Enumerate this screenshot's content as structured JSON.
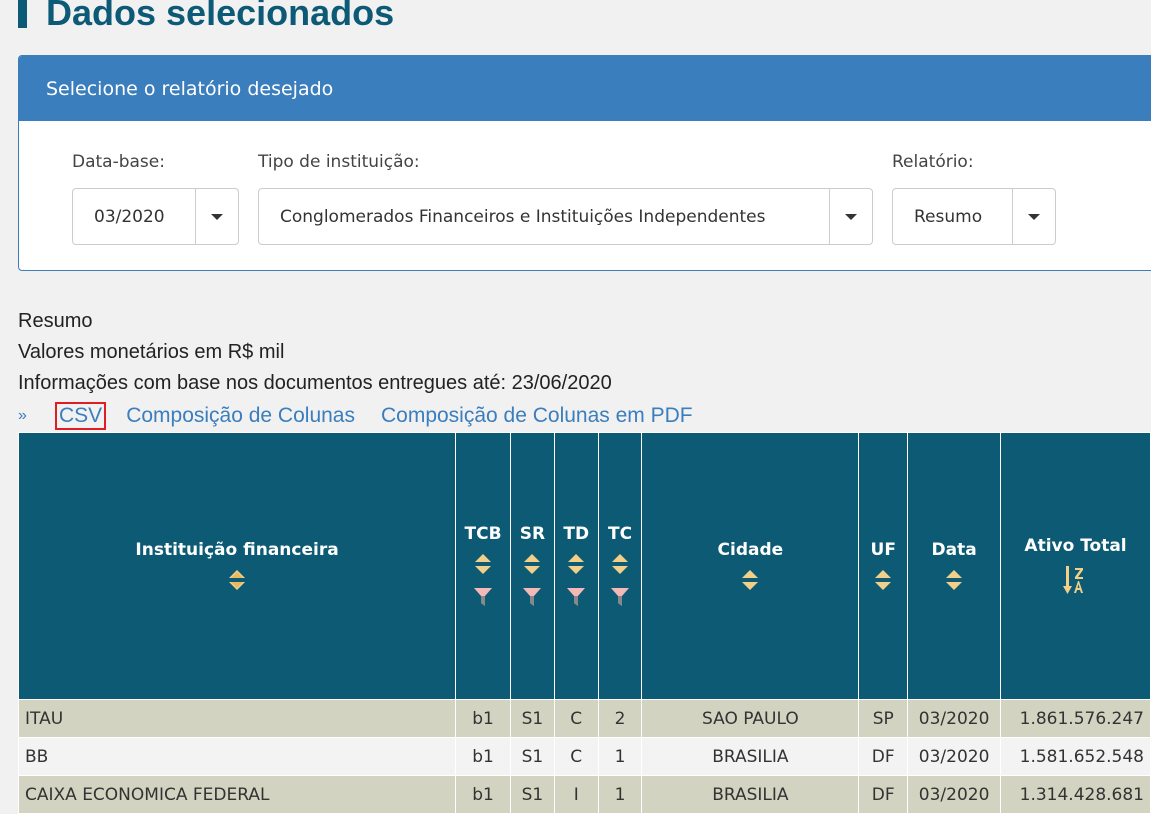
{
  "page": {
    "title": "Dados selecionados"
  },
  "panel": {
    "header": "Selecione o relatório desejado",
    "fields": [
      {
        "label": "Data-base:",
        "value": "03/2020"
      },
      {
        "label": "Tipo de instituição:",
        "value": "Conglomerados Financeiros e Instituições Independentes"
      },
      {
        "label": "Relatório:",
        "value": "Resumo"
      }
    ]
  },
  "info": {
    "line1": "Resumo",
    "line2": "Valores monetários em R$ mil",
    "line3": "Informações com base nos documentos entregues até: 23/06/2020"
  },
  "links": {
    "expand_icon": "double-chevron-down-icon",
    "csv": "CSV",
    "composicao": "Composição de Colunas",
    "composicao_pdf": "Composição de Colunas em PDF"
  },
  "colors": {
    "header_bg": "#0c5a73",
    "panel_header": "#3b7ebd",
    "row_alt": "#d3d3c2",
    "highlight": "#e01c24"
  },
  "table": {
    "columns": [
      "Instituição financeira",
      "TCB",
      "SR",
      "TD",
      "TC",
      "Cidade",
      "UF",
      "Data",
      "Ativo Total"
    ],
    "rows": [
      [
        "ITAU",
        "b1",
        "S1",
        "C",
        "2",
        "SAO PAULO",
        "SP",
        "03/2020",
        "1.861.576.247"
      ],
      [
        "BB",
        "b1",
        "S1",
        "C",
        "1",
        "BRASILIA",
        "DF",
        "03/2020",
        "1.581.652.548"
      ],
      [
        "CAIXA ECONOMICA FEDERAL",
        "b1",
        "S1",
        "I",
        "1",
        "BRASILIA",
        "DF",
        "03/2020",
        "1.314.428.681"
      ]
    ]
  }
}
